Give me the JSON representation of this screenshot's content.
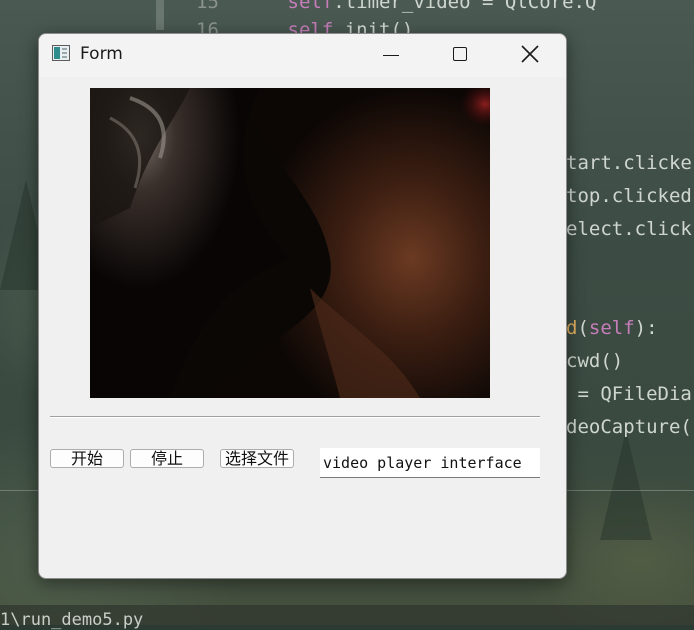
{
  "background": {
    "code_lines": [
      {
        "text": "self.timer_video = QtCore.Q",
        "prefix": "15"
      },
      {
        "text": "self.init()",
        "prefix": "16"
      },
      {
        "text": "tart.clicke"
      },
      {
        "text": "top.clicked"
      },
      {
        "text": "elect.click"
      },
      {
        "text": "d(self):"
      },
      {
        "text": "cwd()"
      },
      {
        "text": " = QFileDia"
      },
      {
        "text": "deoCapture("
      }
    ],
    "terminal_text": "1\\run_demo5.py"
  },
  "window": {
    "title": "Form",
    "icon": "app-form-icon",
    "controls": {
      "minimize": "minimize-icon",
      "maximize": "maximize-icon",
      "close": "close-icon"
    }
  },
  "video": {
    "description_icon": "video-frame"
  },
  "buttons": {
    "start": "开始",
    "stop": "停止",
    "select_file": "选择文件"
  },
  "path_field": {
    "value": "video player interface"
  },
  "colors": {
    "window_bg": "#f0f0f0",
    "titlebar_bg": "#f3f3f3",
    "video_bg": "#0a0604"
  }
}
